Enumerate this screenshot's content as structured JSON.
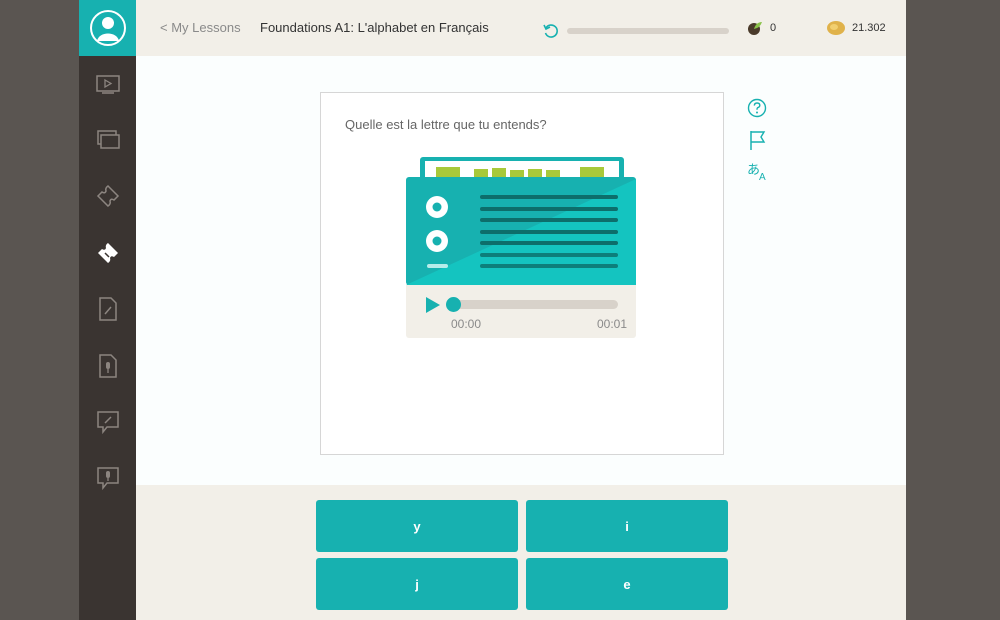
{
  "colors": {
    "accent": "#17b1b0",
    "sidebar": "#3a3431",
    "topbar": "#f2efe8"
  },
  "sidebar": {
    "avatar_icon": "user-avatar-icon",
    "items": [
      {
        "icon": "video-icon",
        "active": false
      },
      {
        "icon": "cards-icon",
        "active": false
      },
      {
        "icon": "puzzle-icon",
        "active": false
      },
      {
        "icon": "puzzle-active-icon",
        "active": true
      },
      {
        "icon": "pencil-doc-icon",
        "active": false
      },
      {
        "icon": "mic-doc-icon",
        "active": false
      },
      {
        "icon": "write-chat-icon",
        "active": false
      },
      {
        "icon": "speak-chat-icon",
        "active": false
      }
    ]
  },
  "header": {
    "back_label": "< My Lessons",
    "lesson_title": "Foundations A1: L'alphabet en Français",
    "progress": 0,
    "streak_count": "0",
    "coins": "21.302"
  },
  "exercise": {
    "question": "Quelle est la lettre que tu entends?",
    "audio": {
      "current_time": "00:00",
      "duration": "00:01",
      "progress": 0
    }
  },
  "tools": [
    "help-icon",
    "flag-icon",
    "translate-icon"
  ],
  "answers": [
    {
      "label": "y"
    },
    {
      "label": "i"
    },
    {
      "label": "j"
    },
    {
      "label": "e"
    }
  ]
}
